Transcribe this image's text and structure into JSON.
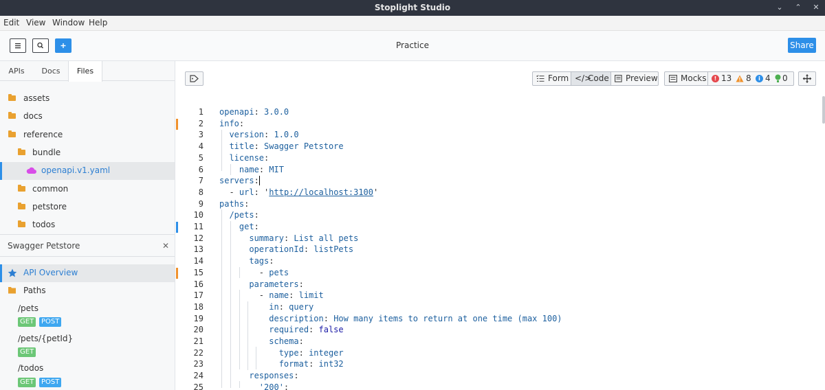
{
  "window": {
    "title": "Stoplight Studio",
    "minimize": "⌄",
    "maximize": "⌃",
    "close": "✕"
  },
  "menu": [
    "Edit",
    "View",
    "Window",
    "Help"
  ],
  "toolbar": {
    "project": "Practice",
    "share_label": "Share",
    "menu_icon": "≡",
    "search_icon": "⚲",
    "add_icon": "+"
  },
  "sidebar": {
    "tabs": [
      "APIs",
      "Docs",
      "Files"
    ],
    "active_tab": "Files",
    "tree": [
      {
        "label": "assets",
        "depth": 0
      },
      {
        "label": "docs",
        "depth": 0
      },
      {
        "label": "reference",
        "depth": 0
      },
      {
        "label": "bundle",
        "depth": 1
      },
      {
        "label": "openapi.v1.yaml",
        "depth": 2,
        "selected": true
      },
      {
        "label": "common",
        "depth": 1
      },
      {
        "label": "petstore",
        "depth": 1
      },
      {
        "label": "todos",
        "depth": 1
      }
    ],
    "api_title": "Swagger Petstore",
    "close_icon": "✕",
    "nav": {
      "overview": "API Overview",
      "paths": "Paths"
    },
    "paths": [
      {
        "path": "/pets",
        "methods": [
          "GET",
          "POST"
        ]
      },
      {
        "path": "/pets/{petId}",
        "methods": [
          "GET"
        ]
      },
      {
        "path": "/todos",
        "methods": [
          "GET",
          "POST"
        ]
      }
    ]
  },
  "editor": {
    "view_modes": [
      "Form",
      "Code",
      "Preview"
    ],
    "active_mode": "Code",
    "mocks_label": "Mocks",
    "counts": {
      "errors": "13",
      "warnings": "8",
      "info": "4",
      "hints": "0"
    },
    "code_lines": [
      {
        "n": "1",
        "k": "openapi",
        "v": "3.0.0"
      },
      {
        "n": "2",
        "k": "info",
        "v": ""
      },
      {
        "n": "3",
        "k": "version",
        "v": "1.0.0"
      },
      {
        "n": "4",
        "k": "title",
        "v": "Swagger Petstore"
      },
      {
        "n": "5",
        "k": "license",
        "v": ""
      },
      {
        "n": "6",
        "k": "name",
        "v": "MIT"
      },
      {
        "n": "7",
        "k": "servers",
        "v": ""
      },
      {
        "n": "8",
        "k": "url",
        "v": "http://localhost:3100"
      },
      {
        "n": "9",
        "k": "paths",
        "v": ""
      },
      {
        "n": "10",
        "k": "/pets",
        "v": ""
      },
      {
        "n": "11",
        "k": "get",
        "v": ""
      },
      {
        "n": "12",
        "k": "summary",
        "v": "List all pets"
      },
      {
        "n": "13",
        "k": "operationId",
        "v": "listPets"
      },
      {
        "n": "14",
        "k": "tags",
        "v": ""
      },
      {
        "n": "15",
        "k": "",
        "v": "pets"
      },
      {
        "n": "16",
        "k": "parameters",
        "v": ""
      },
      {
        "n": "17",
        "k": "name",
        "v": "limit"
      },
      {
        "n": "18",
        "k": "in",
        "v": "query"
      },
      {
        "n": "19",
        "k": "description",
        "v": "How many items to return at one time (max 100)"
      },
      {
        "n": "20",
        "k": "required",
        "v": "false"
      },
      {
        "n": "21",
        "k": "schema",
        "v": ""
      },
      {
        "n": "22",
        "k": "type",
        "v": "integer"
      },
      {
        "n": "23",
        "k": "format",
        "v": "int32"
      },
      {
        "n": "24",
        "k": "responses",
        "v": ""
      },
      {
        "n": "25",
        "k": "'200'",
        "v": ""
      }
    ],
    "colors": {
      "orange_mark": "#f0922d",
      "blue_mark": "#2d8fe8",
      "error": "#e5484d",
      "warning": "#f0922d",
      "info": "#2d8fe8",
      "hint": "#4caf50"
    }
  }
}
